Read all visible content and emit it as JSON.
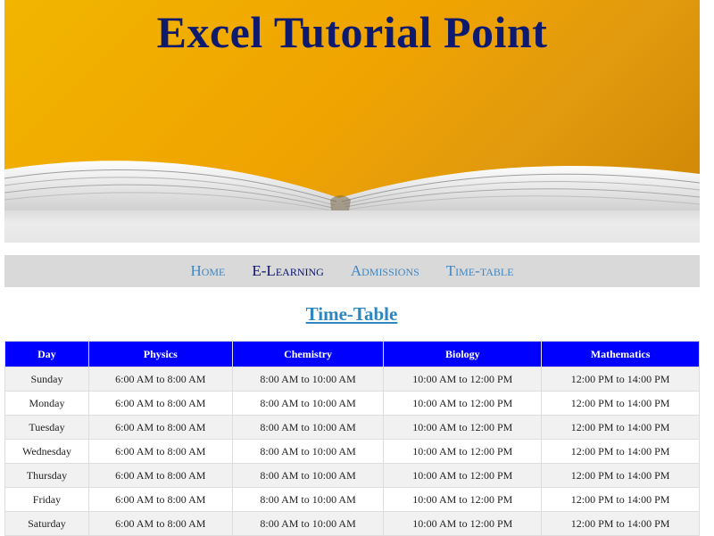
{
  "banner": {
    "title": "Excel Tutorial Point"
  },
  "nav": {
    "items": [
      {
        "label": "Home"
      },
      {
        "label": "E-Learning"
      },
      {
        "label": "Admissions"
      },
      {
        "label": "Time-table"
      }
    ],
    "active_index": 1
  },
  "page": {
    "heading": "Time-Table"
  },
  "timetable": {
    "headers": [
      "Day",
      "Physics",
      "Chemistry",
      "Biology",
      "Mathematics"
    ],
    "rows": [
      [
        "Sunday",
        "6:00 AM to 8:00 AM",
        "8:00 AM to 10:00 AM",
        "10:00 AM to 12:00 PM",
        "12:00 PM to 14:00 PM"
      ],
      [
        "Monday",
        "6:00 AM to 8:00 AM",
        "8:00 AM to 10:00 AM",
        "10:00 AM to 12:00 PM",
        "12:00 PM to 14:00 PM"
      ],
      [
        "Tuesday",
        "6:00 AM to 8:00 AM",
        "8:00 AM to 10:00 AM",
        "10:00 AM to 12:00 PM",
        "12:00 PM to 14:00 PM"
      ],
      [
        "Wednesday",
        "6:00 AM to 8:00 AM",
        "8:00 AM to 10:00 AM",
        "10:00 AM to 12:00 PM",
        "12:00 PM to 14:00 PM"
      ],
      [
        "Thursday",
        "6:00 AM to 8:00 AM",
        "8:00 AM to 10:00 AM",
        "10:00 AM to 12:00 PM",
        "12:00 PM to 14:00 PM"
      ],
      [
        "Friday",
        "6:00 AM to 8:00 AM",
        "8:00 AM to 10:00 AM",
        "10:00 AM to 12:00 PM",
        "12:00 PM to 14:00 PM"
      ],
      [
        "Saturday",
        "6:00 AM to 8:00 AM",
        "8:00 AM to 10:00 AM",
        "10:00 AM to 12:00 PM",
        "12:00 PM to 14:00 PM"
      ]
    ]
  },
  "colors": {
    "banner_bg": "#f0a400",
    "title_color": "#0e1a6e",
    "nav_bg": "#d9d9d9",
    "nav_link": "#3f86c4",
    "nav_active": "#0b1270",
    "heading_color": "#2e86c1",
    "table_header_bg": "#0000ff",
    "table_row_alt": "#f1f1f1"
  }
}
